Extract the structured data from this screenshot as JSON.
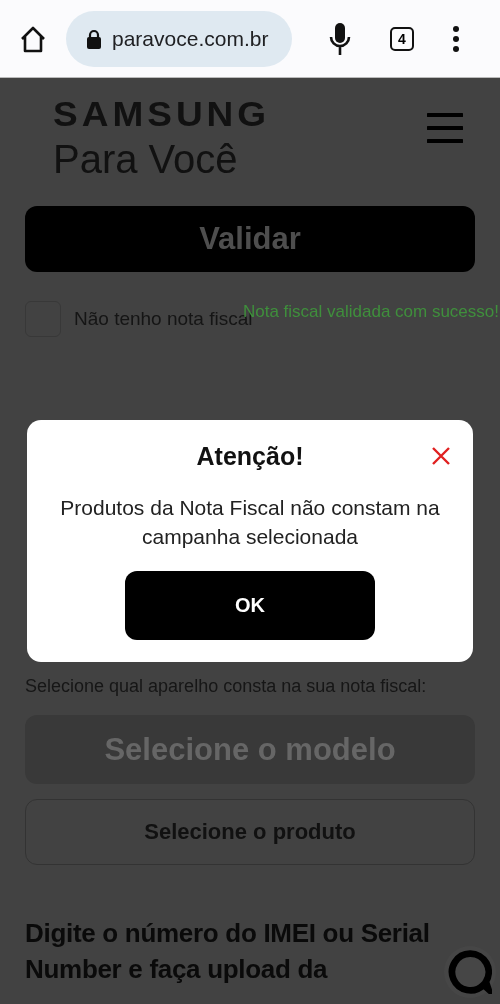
{
  "browser": {
    "url": "paravoce.com.br",
    "tab_count": "4"
  },
  "header": {
    "brand": "SAMSUNG",
    "subtitle": "Para Você"
  },
  "validate_button": {
    "label": "Validar"
  },
  "no_invoice": {
    "label": "Não tenho nota fiscal",
    "checked": false
  },
  "success_message": "Nota fiscal validada com sucesso!",
  "dialog": {
    "title": "Atenção!",
    "message": "Produtos da Nota Fiscal não constam na campanha selecionada",
    "button": "OK"
  },
  "device_prompt": "Selecione qual aparelho consta na sua nota fiscal:",
  "model_select": {
    "label": "Selecione o modelo",
    "disabled": true
  },
  "product_select": {
    "label": "Selecione o produto"
  },
  "imei_heading": "Digite o número do IMEI ou Serial Number e faça upload da"
}
